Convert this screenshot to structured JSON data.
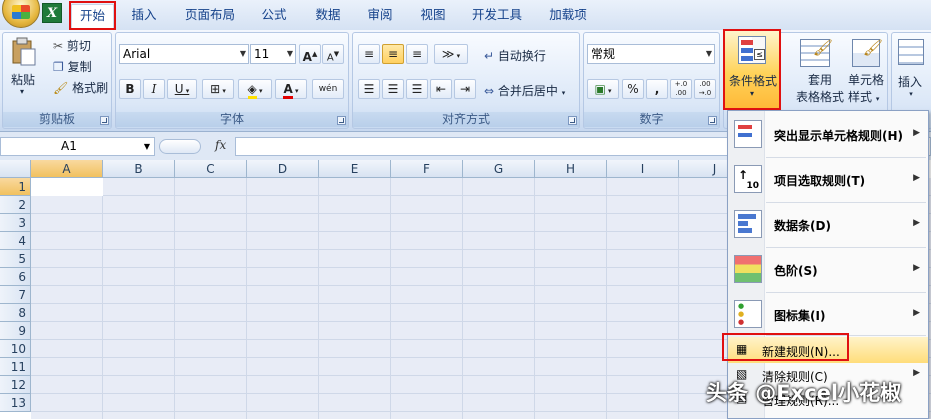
{
  "tabs": [
    "开始",
    "插入",
    "页面布局",
    "公式",
    "数据",
    "审阅",
    "视图",
    "开发工具",
    "加载项"
  ],
  "clipboard": {
    "paste": "粘贴",
    "cut": "剪切",
    "copy": "复制",
    "format_painter": "格式刷",
    "group": "剪贴板"
  },
  "font": {
    "name": "Arial",
    "size": "11",
    "group": "字体",
    "bold": "B",
    "italic": "I",
    "underline": "U",
    "grow": "A",
    "shrink": "A",
    "color_a": "A",
    "phonetic": "wén"
  },
  "alignment": {
    "wrap": "自动换行",
    "merge": "合并后居中",
    "group": "对齐方式"
  },
  "number": {
    "format": "常规",
    "percent": "%",
    "comma": ",",
    "inc_dec": "+.0 .00",
    "dec_dec": ".00 →.0",
    "group": "数字"
  },
  "styles": {
    "conditional": "条件格式",
    "table": "套用\n表格格式",
    "table_l1": "套用",
    "table_l2": "表格格式",
    "cell": "单元格\n样式",
    "cell_l1": "单元格",
    "cell_l2": "样式"
  },
  "cells_group": {
    "insert": "插入"
  },
  "namebox": "A1",
  "fx": "fx",
  "columns": [
    "A",
    "B",
    "C",
    "D",
    "E",
    "F",
    "G",
    "H",
    "I",
    "J"
  ],
  "rows": [
    "1",
    "2",
    "3",
    "4",
    "5",
    "6",
    "7",
    "8",
    "9",
    "10",
    "11",
    "12",
    "13"
  ],
  "menu": {
    "highlight": "突出显示单元格规则(H)",
    "topbottom": "项目选取规则(T)",
    "databars": "数据条(D)",
    "colorscales": "色阶(S)",
    "iconsets": "图标集(I)",
    "new_rule": "新建规则(N)...",
    "clear_rules": "清除规则(C)",
    "manage": "管理规则(R)..."
  },
  "watermark": "头条 @Excel小花椒",
  "colors": {
    "red_outline": "#e01010",
    "tab_text": "#15428b",
    "menu_hover": "#ffdd7a"
  }
}
